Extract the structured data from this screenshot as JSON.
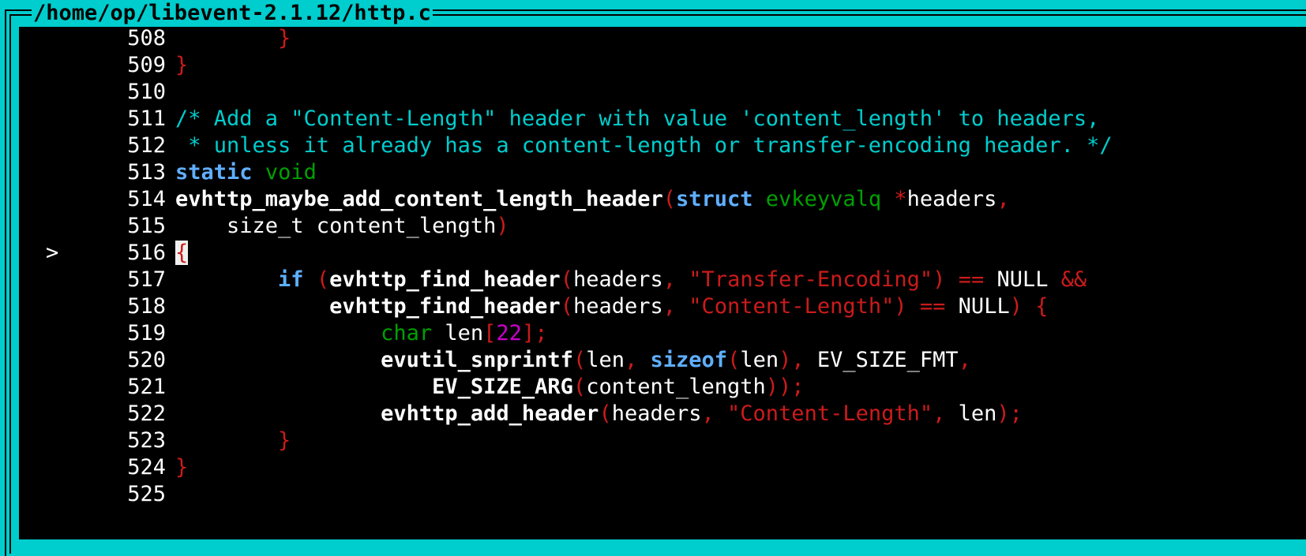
{
  "window": {
    "title": "/home/op/libevent-2.1.12/http.c"
  },
  "colors": {
    "frame": "#00cdcd",
    "background": "#000000",
    "keyword": "#5fafff",
    "type": "#00a000",
    "punct": "#cc1b1b",
    "string": "#cc1b1b",
    "number": "#cc00cc",
    "comment": "#00cdcd"
  },
  "code": {
    "lines": [
      {
        "num": "508",
        "marker": "",
        "tokens": [
          [
            "id",
            "        "
          ],
          [
            "punct",
            "}"
          ]
        ]
      },
      {
        "num": "509",
        "marker": "",
        "tokens": [
          [
            "punct",
            "}"
          ]
        ]
      },
      {
        "num": "510",
        "marker": "",
        "tokens": []
      },
      {
        "num": "511",
        "marker": "",
        "tokens": [
          [
            "comment",
            "/* Add a \"Content-Length\" header with value 'content_length' to headers,"
          ]
        ]
      },
      {
        "num": "512",
        "marker": "",
        "tokens": [
          [
            "comment",
            " * unless it already has a content-length or transfer-encoding header. */"
          ]
        ]
      },
      {
        "num": "513",
        "marker": "",
        "tokens": [
          [
            "kw",
            "static"
          ],
          [
            "id",
            " "
          ],
          [
            "type",
            "void"
          ]
        ]
      },
      {
        "num": "514",
        "marker": "",
        "tokens": [
          [
            "fn",
            "evhttp_maybe_add_content_length_header"
          ],
          [
            "punct",
            "("
          ],
          [
            "kw",
            "struct"
          ],
          [
            "id",
            " "
          ],
          [
            "type",
            "evkeyvalq"
          ],
          [
            "id",
            " "
          ],
          [
            "punct",
            "*"
          ],
          [
            "id",
            "headers"
          ],
          [
            "punct",
            ","
          ]
        ]
      },
      {
        "num": "515",
        "marker": "",
        "tokens": [
          [
            "id",
            "    size_t content_length"
          ],
          [
            "punct",
            ")"
          ]
        ]
      },
      {
        "num": "516",
        "marker": ">",
        "tokens": [
          [
            "cursor",
            "{"
          ]
        ]
      },
      {
        "num": "517",
        "marker": "",
        "tokens": [
          [
            "id",
            "        "
          ],
          [
            "kw",
            "if"
          ],
          [
            "id",
            " "
          ],
          [
            "punct",
            "("
          ],
          [
            "fn",
            "evhttp_find_header"
          ],
          [
            "punct",
            "("
          ],
          [
            "id",
            "headers"
          ],
          [
            "punct",
            ","
          ],
          [
            "id",
            " "
          ],
          [
            "str",
            "\"Transfer-Encoding\""
          ],
          [
            "punct",
            ")"
          ],
          [
            "id",
            " "
          ],
          [
            "punct",
            "=="
          ],
          [
            "id",
            " NULL "
          ],
          [
            "punct",
            "&&"
          ]
        ]
      },
      {
        "num": "518",
        "marker": "",
        "tokens": [
          [
            "id",
            "            "
          ],
          [
            "fn",
            "evhttp_find_header"
          ],
          [
            "punct",
            "("
          ],
          [
            "id",
            "headers"
          ],
          [
            "punct",
            ","
          ],
          [
            "id",
            " "
          ],
          [
            "str",
            "\"Content-Length\""
          ],
          [
            "punct",
            ")"
          ],
          [
            "id",
            " "
          ],
          [
            "punct",
            "=="
          ],
          [
            "id",
            " NULL"
          ],
          [
            "punct",
            ")"
          ],
          [
            "id",
            " "
          ],
          [
            "punct",
            "{"
          ]
        ]
      },
      {
        "num": "519",
        "marker": "",
        "tokens": [
          [
            "id",
            "                "
          ],
          [
            "type",
            "char"
          ],
          [
            "id",
            " len"
          ],
          [
            "punct",
            "["
          ],
          [
            "num",
            "22"
          ],
          [
            "punct",
            "];"
          ]
        ]
      },
      {
        "num": "520",
        "marker": "",
        "tokens": [
          [
            "id",
            "                "
          ],
          [
            "fn",
            "evutil_snprintf"
          ],
          [
            "punct",
            "("
          ],
          [
            "id",
            "len"
          ],
          [
            "punct",
            ","
          ],
          [
            "id",
            " "
          ],
          [
            "kw",
            "sizeof"
          ],
          [
            "punct",
            "("
          ],
          [
            "id",
            "len"
          ],
          [
            "punct",
            "),"
          ],
          [
            "id",
            " EV_SIZE_FMT"
          ],
          [
            "punct",
            ","
          ]
        ]
      },
      {
        "num": "521",
        "marker": "",
        "tokens": [
          [
            "id",
            "                    "
          ],
          [
            "fn",
            "EV_SIZE_ARG"
          ],
          [
            "punct",
            "("
          ],
          [
            "id",
            "content_length"
          ],
          [
            "punct",
            "));"
          ]
        ]
      },
      {
        "num": "522",
        "marker": "",
        "tokens": [
          [
            "id",
            "                "
          ],
          [
            "fn",
            "evhttp_add_header"
          ],
          [
            "punct",
            "("
          ],
          [
            "id",
            "headers"
          ],
          [
            "punct",
            ","
          ],
          [
            "id",
            " "
          ],
          [
            "str",
            "\"Content-Length\""
          ],
          [
            "punct",
            ","
          ],
          [
            "id",
            " len"
          ],
          [
            "punct",
            ");"
          ]
        ]
      },
      {
        "num": "523",
        "marker": "",
        "tokens": [
          [
            "id",
            "        "
          ],
          [
            "punct",
            "}"
          ]
        ]
      },
      {
        "num": "524",
        "marker": "",
        "tokens": [
          [
            "punct",
            "}"
          ]
        ]
      },
      {
        "num": "525",
        "marker": "",
        "tokens": []
      }
    ]
  }
}
